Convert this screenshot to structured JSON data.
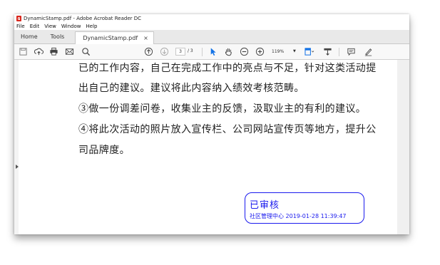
{
  "window": {
    "title": "DynamicStamp.pdf - Adobe Acrobat Reader DC"
  },
  "menu": [
    "File",
    "Edit",
    "View",
    "Window",
    "Help"
  ],
  "tabs": {
    "home": "Home",
    "tools": "Tools",
    "document": "DynamicStamp.pdf",
    "close_glyph": "×"
  },
  "toolbar": {
    "current_page": "3",
    "page_total": "/ 3",
    "zoom": "119%",
    "zoom_arrow": "▼",
    "icons": [
      "save-icon",
      "upload-icon",
      "print-icon",
      "email-icon",
      "search-icon",
      "page-up-icon",
      "page-down-icon",
      "select-cursor-icon",
      "hand-icon",
      "zoom-out-icon",
      "zoom-in-icon",
      "fit-page-icon",
      "scroll-mode-icon",
      "comment-icon",
      "sign-icon"
    ]
  },
  "document": {
    "lines": [
      "已的工作内容，自己在完成工作中的亮点与不足，针对这类活动提",
      "出自己的建议。建议将此内容纳入绩效考核范畴。",
      "③做一份调差问卷，收集业主的反馈，汲取业主的有利的建议。",
      "④将此次活动的照片放入宣传栏、公司网站宣传页等地方，提升公",
      "司品牌度。"
    ],
    "stamp": {
      "title": "已审核",
      "detail": "社区管理中心 2019-01-28 11:39:47",
      "color": "#1a1aee"
    }
  }
}
